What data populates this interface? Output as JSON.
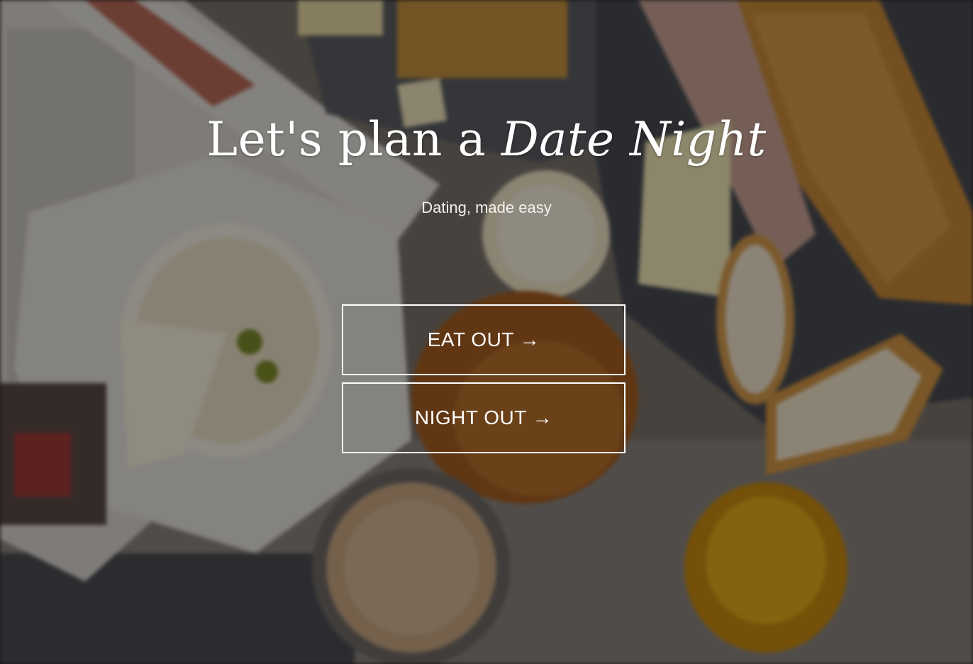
{
  "hero": {
    "title_plain": "Let's plan a ",
    "title_emphasis": "Date Night",
    "subtitle": "Dating, made easy"
  },
  "actions": {
    "eat_out_label": "EAT OUT →",
    "night_out_label": "NIGHT OUT →"
  },
  "background": {
    "image_subject": "food-flatlay-photo"
  }
}
